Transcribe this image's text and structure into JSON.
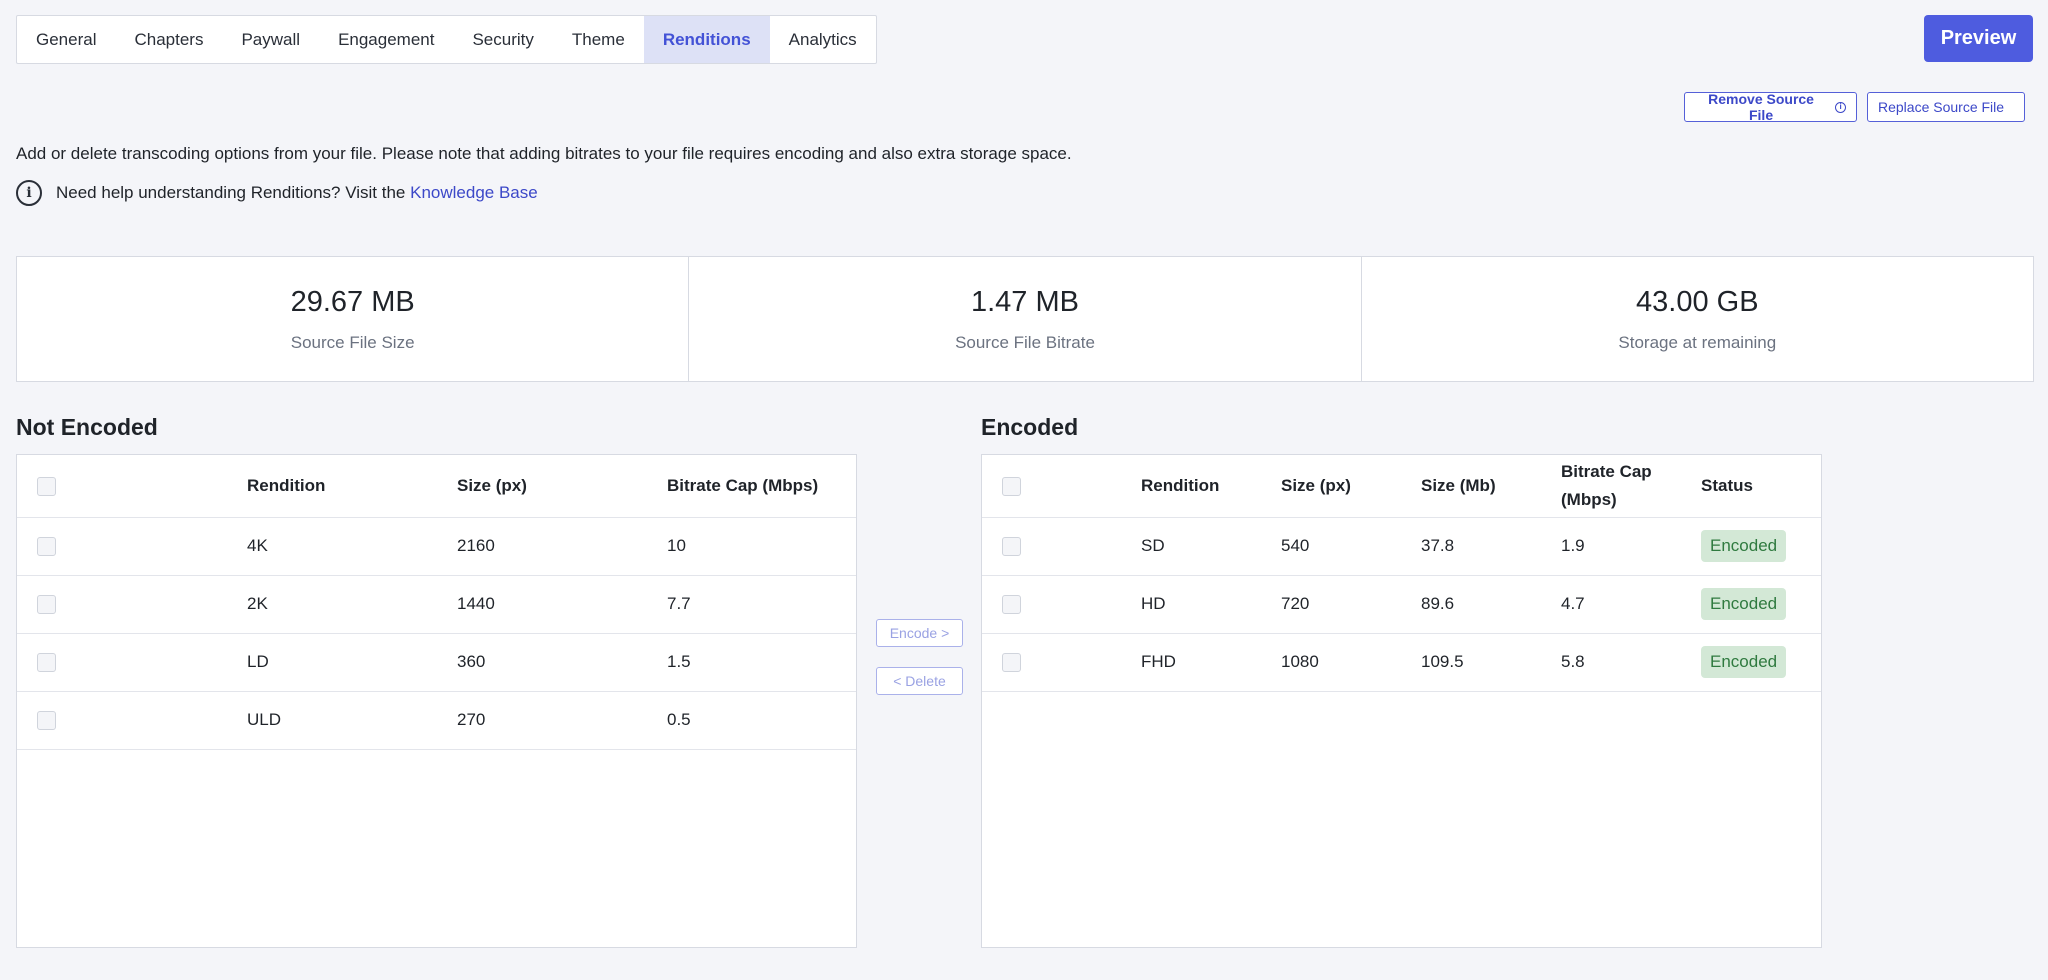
{
  "tabs": [
    "General",
    "Chapters",
    "Paywall",
    "Engagement",
    "Security",
    "Theme",
    "Renditions",
    "Analytics"
  ],
  "active_tab": "Renditions",
  "preview_label": "Preview",
  "source_buttons": {
    "remove_label": "Remove Source File",
    "replace_label": "Replace Source File"
  },
  "description": "Add or delete transcoding options from your file. Please note that adding bitrates to your file requires encoding and also extra storage space.",
  "help": {
    "text": "Need help understanding Renditions? Visit the",
    "link_text": "Knowledge Base"
  },
  "stats": [
    {
      "value": "29.67 MB",
      "label": "Source File Size"
    },
    {
      "value": "1.47 MB",
      "label": "Source File Bitrate"
    },
    {
      "value": "43.00 GB",
      "label": "Storage at remaining"
    }
  ],
  "not_encoded": {
    "title": "Not Encoded",
    "headers": [
      "Rendition",
      "Size (px)",
      "Bitrate Cap (Mbps)"
    ],
    "rows": [
      [
        "4K",
        "2160",
        "10"
      ],
      [
        "2K",
        "1440",
        "7.7"
      ],
      [
        "LD",
        "360",
        "1.5"
      ],
      [
        "ULD",
        "270",
        "0.5"
      ]
    ]
  },
  "encoded": {
    "title": "Encoded",
    "headers": [
      "Rendition",
      "Size (px)",
      "Size (Mb)",
      "Bitrate Cap (Mbps)",
      "Status"
    ],
    "rows": [
      [
        "SD",
        "540",
        "37.8",
        "1.9",
        "Encoded"
      ],
      [
        "HD",
        "720",
        "89.6",
        "4.7",
        "Encoded"
      ],
      [
        "FHD",
        "1080",
        "109.5",
        "5.8",
        "Encoded"
      ]
    ]
  },
  "actions": {
    "encode_label": "Encode >",
    "delete_label": "< Delete"
  },
  "colors": {
    "accent": "#4e5cdf",
    "active_tab_bg": "#dde1f6",
    "badge_bg": "#d3e8d6",
    "badge_text": "#2f7a3f",
    "page_bg": "#f4f5f9"
  }
}
